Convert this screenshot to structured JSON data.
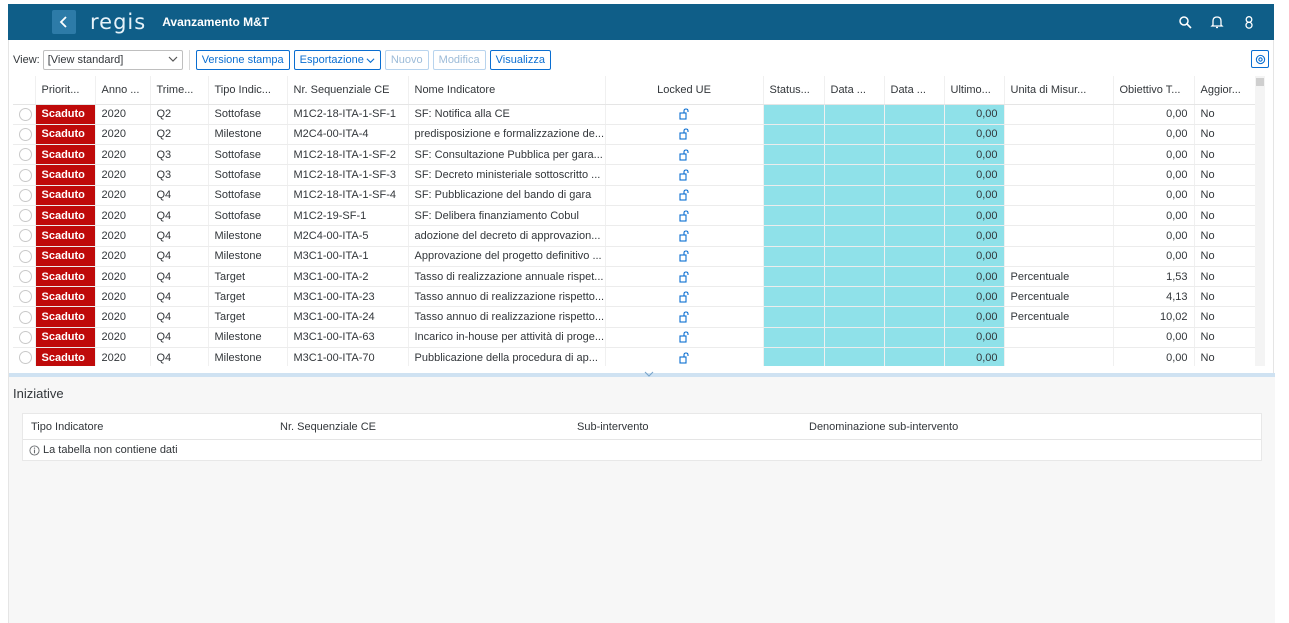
{
  "shell": {
    "logo": "regis",
    "title": "Avanzamento M&T"
  },
  "toolbar": {
    "view_label": "View:",
    "view_value": "[View standard]",
    "print_label": "Versione stampa",
    "export_label": "Esportazione",
    "new_label": "Nuovo",
    "edit_label": "Modifica",
    "display_label": "Visualizza"
  },
  "grid": {
    "columns": [
      "Priorit...",
      "Anno ...",
      "Trime...",
      "Tipo Indic...",
      "Nr. Sequenziale CE",
      "Nome Indicatore",
      "Locked UE",
      "Status...",
      "Data ...",
      "Data ...",
      "Ultimo...",
      "Unita di Misur...",
      "Obiettivo T...",
      "Aggior..."
    ],
    "rows": [
      {
        "prio": "Scaduto",
        "anno": "2020",
        "trim": "Q2",
        "tipo": "Sottofase",
        "seq": "M1C2-18-ITA-1-SF-1",
        "nome": "SF: Notifica alla CE",
        "ultimo": "0,00",
        "unita": "",
        "obiettivo": "0,00",
        "aggior": "No"
      },
      {
        "prio": "Scaduto",
        "anno": "2020",
        "trim": "Q2",
        "tipo": "Milestone",
        "seq": "M2C4-00-ITA-4",
        "nome": "predisposizione e formalizzazione de...",
        "ultimo": "0,00",
        "unita": "",
        "obiettivo": "0,00",
        "aggior": "No"
      },
      {
        "prio": "Scaduto",
        "anno": "2020",
        "trim": "Q3",
        "tipo": "Sottofase",
        "seq": "M1C2-18-ITA-1-SF-2",
        "nome": "SF: Consultazione Pubblica per gara...",
        "ultimo": "0,00",
        "unita": "",
        "obiettivo": "0,00",
        "aggior": "No"
      },
      {
        "prio": "Scaduto",
        "anno": "2020",
        "trim": "Q3",
        "tipo": "Sottofase",
        "seq": "M1C2-18-ITA-1-SF-3",
        "nome": "SF: Decreto ministeriale sottoscritto ...",
        "ultimo": "0,00",
        "unita": "",
        "obiettivo": "0,00",
        "aggior": "No"
      },
      {
        "prio": "Scaduto",
        "anno": "2020",
        "trim": "Q4",
        "tipo": "Sottofase",
        "seq": "M1C2-18-ITA-1-SF-4",
        "nome": "SF: Pubblicazione del bando di gara",
        "ultimo": "0,00",
        "unita": "",
        "obiettivo": "0,00",
        "aggior": "No"
      },
      {
        "prio": "Scaduto",
        "anno": "2020",
        "trim": "Q4",
        "tipo": "Sottofase",
        "seq": "M1C2-19-SF-1",
        "nome": "SF: Delibera finanziamento Cobul",
        "ultimo": "0,00",
        "unita": "",
        "obiettivo": "0,00",
        "aggior": "No"
      },
      {
        "prio": "Scaduto",
        "anno": "2020",
        "trim": "Q4",
        "tipo": "Milestone",
        "seq": "M2C4-00-ITA-5",
        "nome": "adozione del decreto di approvazion...",
        "ultimo": "0,00",
        "unita": "",
        "obiettivo": "0,00",
        "aggior": "No"
      },
      {
        "prio": "Scaduto",
        "anno": "2020",
        "trim": "Q4",
        "tipo": "Milestone",
        "seq": "M3C1-00-ITA-1",
        "nome": "Approvazione del progetto definitivo ...",
        "ultimo": "0,00",
        "unita": "",
        "obiettivo": "0,00",
        "aggior": "No"
      },
      {
        "prio": "Scaduto",
        "anno": "2020",
        "trim": "Q4",
        "tipo": "Target",
        "seq": "M3C1-00-ITA-2",
        "nome": "Tasso di realizzazione annuale rispet...",
        "ultimo": "0,00",
        "unita": "Percentuale",
        "obiettivo": "1,53",
        "aggior": "No"
      },
      {
        "prio": "Scaduto",
        "anno": "2020",
        "trim": "Q4",
        "tipo": "Target",
        "seq": "M3C1-00-ITA-23",
        "nome": "Tasso annuo di realizzazione rispetto...",
        "ultimo": "0,00",
        "unita": "Percentuale",
        "obiettivo": "4,13",
        "aggior": "No"
      },
      {
        "prio": "Scaduto",
        "anno": "2020",
        "trim": "Q4",
        "tipo": "Target",
        "seq": "M3C1-00-ITA-24",
        "nome": "Tasso annuo di realizzazione rispetto...",
        "ultimo": "0,00",
        "unita": "Percentuale",
        "obiettivo": "10,02",
        "aggior": "No"
      },
      {
        "prio": "Scaduto",
        "anno": "2020",
        "trim": "Q4",
        "tipo": "Milestone",
        "seq": "M3C1-00-ITA-63",
        "nome": "Incarico in-house per attività di proge...",
        "ultimo": "0,00",
        "unita": "",
        "obiettivo": "0,00",
        "aggior": "No"
      },
      {
        "prio": "Scaduto",
        "anno": "2020",
        "trim": "Q4",
        "tipo": "Milestone",
        "seq": "M3C1-00-ITA-70",
        "nome": "Pubblicazione della procedura di ap...",
        "ultimo": "0,00",
        "unita": "",
        "obiettivo": "0,00",
        "aggior": "No"
      }
    ]
  },
  "iniziative": {
    "title": "Iniziative",
    "columns": [
      "Tipo Indicatore",
      "Nr. Sequenziale CE",
      "Sub-intervento",
      "Denominazione sub-intervento"
    ],
    "no_data": "La tabella non contiene dati"
  },
  "colors": {
    "shell": "#0f5e88",
    "priority_overdue": "#bf0a0a",
    "highlight": "#8fe1e9",
    "accent": "#0a6ed1"
  },
  "icons": {
    "back": "back-icon",
    "search": "search-icon",
    "notifications": "bell-icon",
    "user": "user-icon",
    "settings": "settings-icon",
    "lock": "unlocked-padlock-icon"
  }
}
